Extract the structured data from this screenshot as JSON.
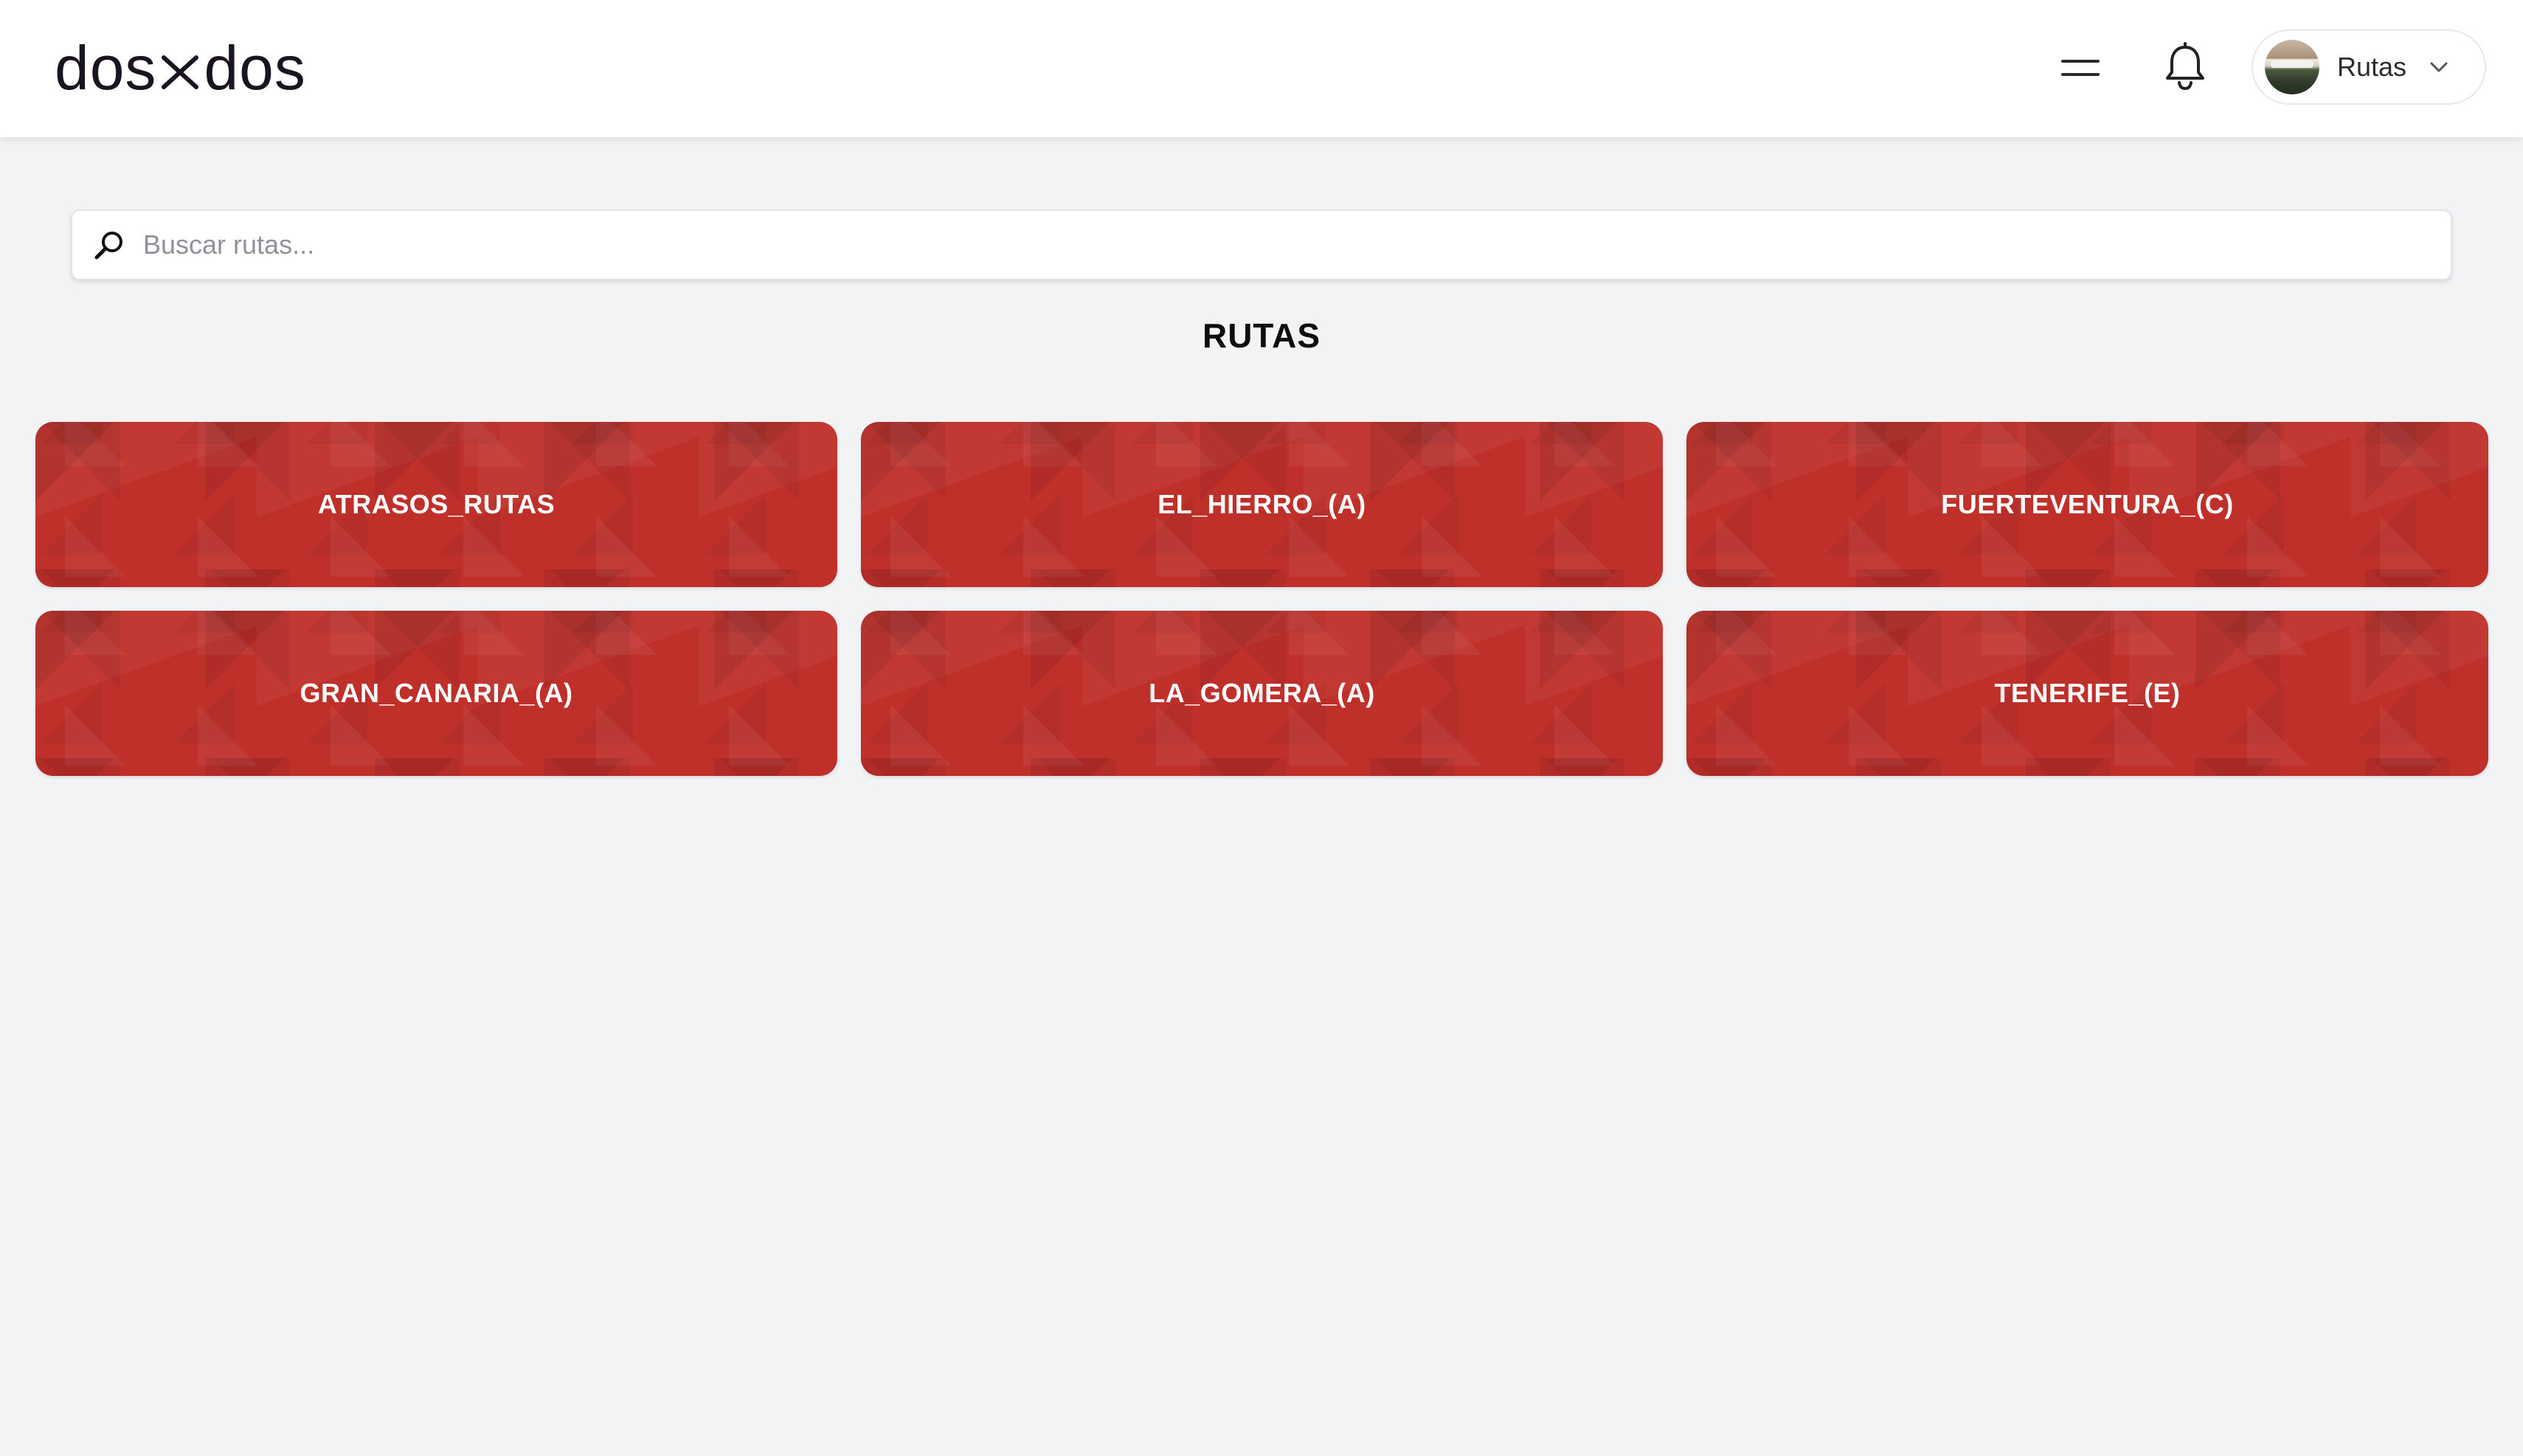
{
  "header": {
    "logo_left": "dos",
    "logo_right": "dos",
    "menu_icon": "hamburger-menu-icon",
    "notification_icon": "bell-icon",
    "user_menu": {
      "label": "Rutas",
      "chevron_icon": "chevron-down-icon"
    }
  },
  "search": {
    "placeholder": "Buscar rutas...",
    "value": "",
    "icon": "search-icon"
  },
  "page": {
    "title": "RUTAS"
  },
  "routes": [
    {
      "label": "ATRASOS_RUTAS"
    },
    {
      "label": "EL_HIERRO_(A)"
    },
    {
      "label": "FUERTEVENTURA_(C)"
    },
    {
      "label": "GRAN_CANARIA_(A)"
    },
    {
      "label": "LA_GOMERA_(A)"
    },
    {
      "label": "TENERIFE_(E)"
    }
  ],
  "colors": {
    "card_red": "#c0302b",
    "background": "#f2f3f5",
    "header_bg": "#ffffff"
  }
}
